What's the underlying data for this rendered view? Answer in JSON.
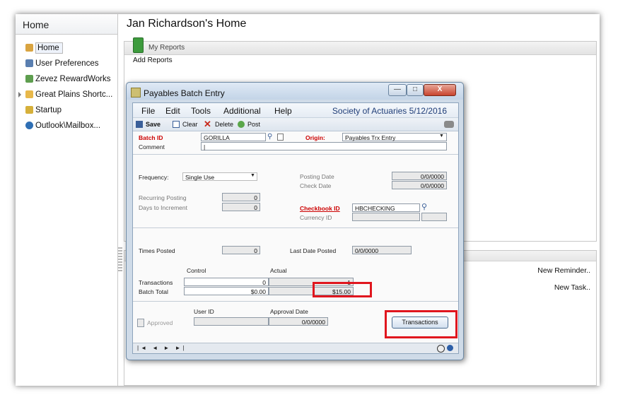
{
  "sidebar": {
    "title": "Home",
    "items": [
      {
        "label": "Home",
        "icon": "home-icon",
        "color": "#d9a441"
      },
      {
        "label": "User Preferences",
        "icon": "user-preferences-icon",
        "color": "#5a7fb0"
      },
      {
        "label": "Zevez RewardWorks",
        "icon": "rewardworks-icon",
        "color": "#5e9e4f"
      },
      {
        "label": "Great Plains Shortc...",
        "icon": "folder-icon",
        "color": "#e8b84a"
      },
      {
        "label": "Startup",
        "icon": "startup-icon",
        "color": "#d6b03a"
      },
      {
        "label": "Outlook\\Mailbox...",
        "icon": "outlook-icon",
        "color": "#2f6fb4"
      }
    ]
  },
  "main": {
    "title": "Jan Richardson's Home",
    "reports_header": "My Reports",
    "add_reports": "Add Reports",
    "new_reminder": "New Reminder..",
    "new_task": "New Task.."
  },
  "dialog": {
    "title": "Payables Batch Entry",
    "window_buttons": {
      "minimize": "—",
      "maximize": "□",
      "close": "X"
    },
    "menu": [
      "File",
      "Edit",
      "Tools",
      "Additional",
      "Help"
    ],
    "company_date": "Society of Actuaries  5/12/2016",
    "toolbar": {
      "save": "Save",
      "clear": "Clear",
      "delete": "Delete",
      "post": "Post"
    },
    "fields": {
      "batch_id_label": "Batch ID",
      "batch_id_value": "GORILLA",
      "origin_label": "Origin:",
      "origin_value": "Payables Trx Entry",
      "comment_label": "Comment",
      "comment_value": "|",
      "frequency_label": "Frequency:",
      "frequency_value": "Single Use",
      "posting_date_label": "Posting Date",
      "posting_date_value": "0/0/0000",
      "check_date_label": "Check Date",
      "check_date_value": "0/0/0000",
      "recurring_posting_label": "Recurring Posting",
      "recurring_posting_value": "0",
      "days_to_increment_label": "Days to Increment",
      "days_to_increment_value": "0",
      "checkbook_id_label": "Checkbook ID",
      "checkbook_id_value": "HBCHECKING",
      "currency_id_label": "Currency ID",
      "times_posted_label": "Times Posted",
      "times_posted_value": "0",
      "last_date_posted_label": "Last Date Posted",
      "last_date_posted_value": "0/0/0000",
      "control_label": "Control",
      "actual_label": "Actual",
      "transactions_label": "Transactions",
      "transactions_control": "0",
      "transactions_actual": "1",
      "batch_total_label": "Batch Total",
      "batch_total_control": "$0.00",
      "batch_total_actual": "$15.00",
      "user_id_label": "User ID",
      "approval_date_label": "Approval Date",
      "approval_date_value": "0/0/0000",
      "approved_label": "Approved",
      "transactions_button": "Transactions"
    },
    "highlight_color": "#e0161e"
  }
}
